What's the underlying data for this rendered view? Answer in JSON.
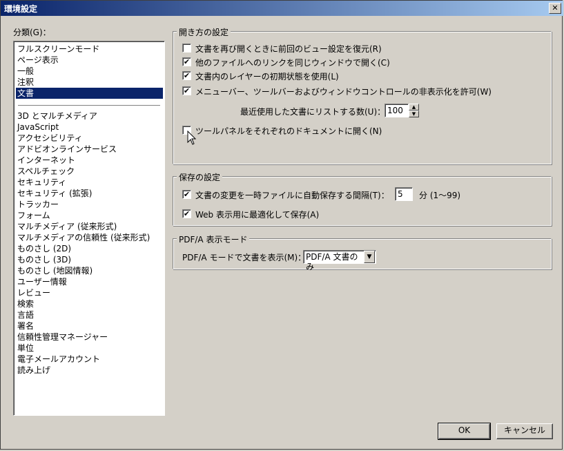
{
  "window": {
    "title": "環境設定",
    "close_glyph": "✕"
  },
  "category": {
    "label": "分類(G)：",
    "items_top": [
      "フルスクリーンモード",
      "ページ表示",
      "一般",
      "注釈",
      "文書"
    ],
    "selected": "文書",
    "items_bottom": [
      "3D とマルチメディア",
      "JavaScript",
      "アクセシビリティ",
      "アドビオンラインサービス",
      "インターネット",
      "スペルチェック",
      "セキュリティ",
      "セキュリティ (拡張)",
      "トラッカー",
      "フォーム",
      "マルチメディア (従来形式)",
      "マルチメディアの信頼性 (従来形式)",
      "ものさし (2D)",
      "ものさし (3D)",
      "ものさし (地図情報)",
      "ユーザー情報",
      "レビュー",
      "検索",
      "言語",
      "署名",
      "信頼性管理マネージャー",
      "単位",
      "電子メールアカウント",
      "読み上げ"
    ]
  },
  "open_settings": {
    "title": "開き方の設定",
    "options": [
      {
        "label": "文書を再び開くときに前回のビュー設定を復元(R)",
        "checked": false
      },
      {
        "label": "他のファイルへのリンクを同じウィンドウで開く(C)",
        "checked": true
      },
      {
        "label": "文書内のレイヤーの初期状態を使用(L)",
        "checked": true
      },
      {
        "label": "メニューバー、ツールバーおよびウィンドウコントロールの非表示化を許可(W)",
        "checked": true
      }
    ],
    "recent_label": "最近使用した文書にリストする数(U)：",
    "recent_value": "100",
    "tool_panel_label": "ツールパネルをそれぞれのドキュメントに開く(N)",
    "tool_panel_checked": false
  },
  "save_settings": {
    "title": "保存の設定",
    "autosave_label": "文書の変更を一時ファイルに自動保存する間隔(T)：",
    "autosave_checked": true,
    "autosave_value": "5",
    "autosave_unit": "分 (1～99)",
    "web_label": "Web 表示用に最適化して保存(A)",
    "web_checked": true
  },
  "pdfa": {
    "title": "PDF/A 表示モード",
    "label": "PDF/A モードで文書を表示(M)：",
    "value": "PDF/A 文書のみ"
  },
  "buttons": {
    "ok": "OK",
    "cancel": "キャンセル"
  },
  "icons": {
    "check": "✔",
    "spin_up": "▲",
    "spin_down": "▼",
    "dropdown": "▼"
  }
}
